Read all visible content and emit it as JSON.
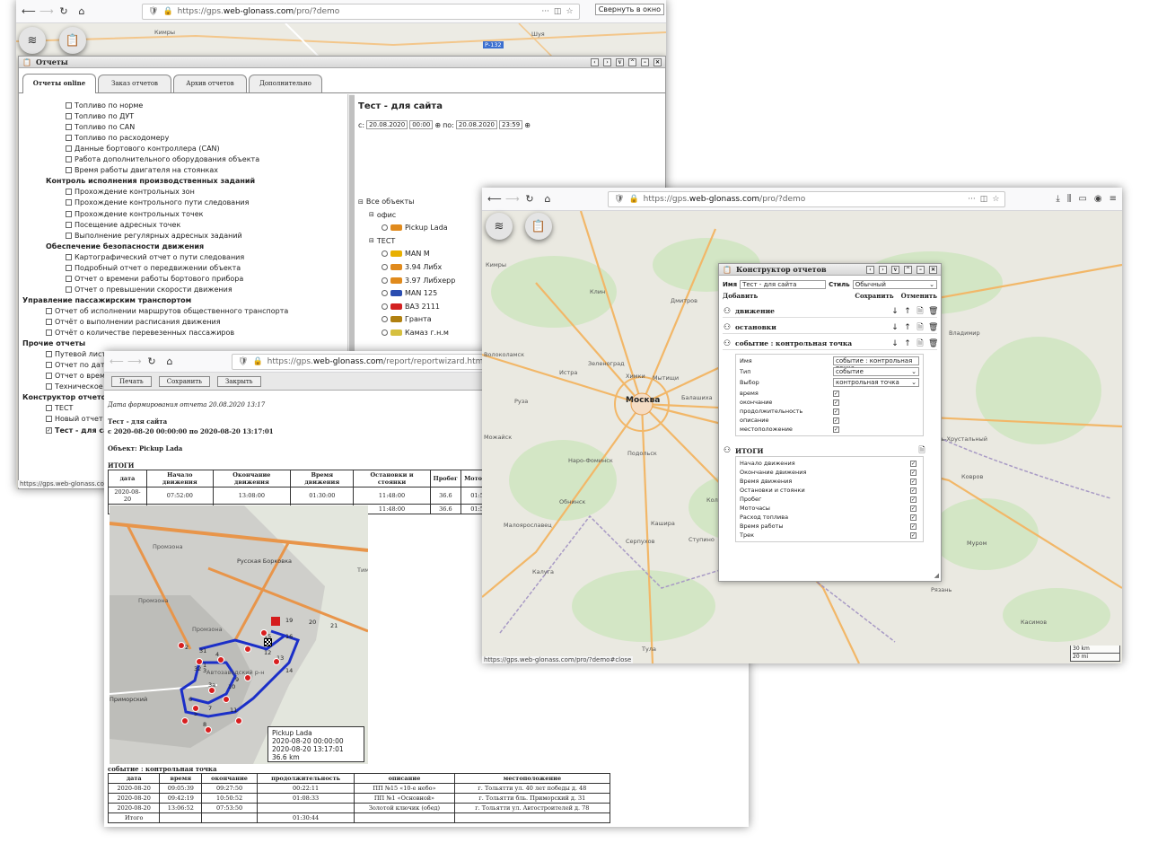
{
  "win1": {
    "url": {
      "prefix": "https://gps.",
      "domain": "web-glonass.com",
      "suffix": "/pro/?demo"
    },
    "tooltip": "Свернуть в окно",
    "map_labels": [
      "Кимры",
      "Шуя",
      "Р-132"
    ],
    "reports_title": "Отчеты",
    "tabs": [
      "Отчеты online",
      "Заказ отчетов",
      "Архив отчетов",
      "Дополнительно"
    ],
    "tree": [
      {
        "t": "Топливо по норме",
        "lvl": 2,
        "k": "cb"
      },
      {
        "t": "Топливо по ДУТ",
        "lvl": 2,
        "k": "cb"
      },
      {
        "t": "Топливо по CAN",
        "lvl": 2,
        "k": "cb"
      },
      {
        "t": "Топливо по расходомеру",
        "lvl": 2,
        "k": "cb"
      },
      {
        "t": "Данные бортового контроллера (CAN)",
        "lvl": 2,
        "k": "cb"
      },
      {
        "t": "Работа дополнительного оборудования объекта",
        "lvl": 2,
        "k": "cb"
      },
      {
        "t": "Время работы двигателя на стоянках",
        "lvl": 2,
        "k": "cb"
      },
      {
        "t": "Контроль исполнения производственных заданий",
        "lvl": 1,
        "k": "hdr"
      },
      {
        "t": "Прохождение контрольных зон",
        "lvl": 2,
        "k": "cb"
      },
      {
        "t": "Прохождение контрольного пути следования",
        "lvl": 2,
        "k": "cb"
      },
      {
        "t": "Прохождение контрольных точек",
        "lvl": 2,
        "k": "cb"
      },
      {
        "t": "Посещение адресных точек",
        "lvl": 2,
        "k": "cb"
      },
      {
        "t": "Выполнение регулярных адресных заданий",
        "lvl": 2,
        "k": "cb"
      },
      {
        "t": "Обеспечение безопасности движения",
        "lvl": 1,
        "k": "hdr"
      },
      {
        "t": "Картографический отчет о пути следования",
        "lvl": 2,
        "k": "cb"
      },
      {
        "t": "Подробный отчет о передвижении объекта",
        "lvl": 2,
        "k": "cb"
      },
      {
        "t": "Отчет о времени работы бортового прибора",
        "lvl": 2,
        "k": "cb"
      },
      {
        "t": "Отчет о превышении скорости движения",
        "lvl": 2,
        "k": "cb"
      },
      {
        "t": "Управление пассажирским транспортом",
        "lvl": 0,
        "k": "hdr"
      },
      {
        "t": "Отчет об исполнении маршрутов общественного транспорта",
        "lvl": 1,
        "k": "cb"
      },
      {
        "t": "Отчёт о выполнении расписания движения",
        "lvl": 1,
        "k": "cb"
      },
      {
        "t": "Отчёт о количестве перевезенных пассажиров",
        "lvl": 1,
        "k": "cb"
      },
      {
        "t": "Прочие отчеты",
        "lvl": 0,
        "k": "hdr"
      },
      {
        "t": "Путевой лист",
        "lvl": 1,
        "k": "cb"
      },
      {
        "t": "Отчет по датчи",
        "lvl": 1,
        "k": "cb"
      },
      {
        "t": "Отчет о времен",
        "lvl": 1,
        "k": "cb"
      },
      {
        "t": "Техническое об",
        "lvl": 1,
        "k": "cb"
      },
      {
        "t": "Конструктор отчетов",
        "lvl": 0,
        "k": "hdr"
      },
      {
        "t": "ТЕСТ",
        "lvl": 1,
        "k": "cb"
      },
      {
        "t": "Новый отчет",
        "lvl": 1,
        "k": "cb"
      },
      {
        "t": "Тест - для сай",
        "lvl": 1,
        "k": "cbx"
      }
    ],
    "report_name": "Тест - для сайта",
    "date_from_label": "с:",
    "date_from": "20.08.2020",
    "time_from": "00:00",
    "date_to_label": "по:",
    "date_to": "20.08.2020",
    "time_to": "23:59",
    "objects": [
      {
        "t": "Все объекты",
        "lvl": 0,
        "k": "grp",
        "c": ""
      },
      {
        "t": "офис",
        "lvl": 1,
        "k": "grp",
        "c": ""
      },
      {
        "t": "Pickup Lada",
        "lvl": 2,
        "k": "obj",
        "c": "#e08a1c"
      },
      {
        "t": "ТЕСТ",
        "lvl": 1,
        "k": "grp",
        "c": ""
      },
      {
        "t": "MAN M",
        "lvl": 2,
        "k": "obj",
        "c": "#e8b000"
      },
      {
        "t": "3.94 Либх",
        "lvl": 2,
        "k": "obj",
        "c": "#e08a1c"
      },
      {
        "t": "3.97 Либхерр",
        "lvl": 2,
        "k": "obj",
        "c": "#e08a1c"
      },
      {
        "t": "MAN 125",
        "lvl": 2,
        "k": "obj",
        "c": "#2a4db0"
      },
      {
        "t": "ВАЗ 2111",
        "lvl": 2,
        "k": "obj",
        "c": "#d32020"
      },
      {
        "t": "Гранта",
        "lvl": 2,
        "k": "obj",
        "c": "#b08010"
      },
      {
        "t": "Камаз г.н.м",
        "lvl": 2,
        "k": "obj",
        "c": "#d6c040"
      }
    ],
    "status_url": "https://gps.web-glonass.com/p"
  },
  "win2": {
    "url": {
      "prefix": "https://gps.",
      "domain": "web-glonass.com",
      "suffix": "/report/reportwizard.html"
    },
    "buttons": [
      "Печать",
      "Сохранить",
      "Закрыть"
    ],
    "date_line": "Дата формирования отчета 20.08.2020 13:17",
    "title": "Тест - для сайта",
    "period": "с 2020-08-20 00:00:00 по 2020-08-20 13:17:01",
    "object_line": "Объект: Pickup Lada",
    "totals_title": "ИТОГИ",
    "totals_headers": [
      "дата",
      "Начало движения",
      "Окончание движения",
      "Время движения",
      "Остановки и стоянки",
      "Пробег",
      "Моточа"
    ],
    "totals_rows": [
      [
        "2020-08-20",
        "07:52:00",
        "13:08:00",
        "01:30:00",
        "11:48:00",
        "36.6",
        "01:5"
      ],
      [
        "Итого",
        "",
        "",
        "01:30:00",
        "11:48:00",
        "36.6",
        "01:5"
      ]
    ],
    "map_labels": [
      "Промзона",
      "Русская Борковка",
      "Промзона",
      "Промзона",
      "Автозаводский р-н",
      "Приморский",
      "Тимо"
    ],
    "track_nums": [
      "19",
      "20",
      "21",
      "15",
      "16",
      "13",
      "12",
      "14",
      "2",
      "31",
      "4",
      "1",
      "32",
      "3",
      "9",
      "3a",
      "6",
      "10",
      "5",
      "7",
      "11",
      "8"
    ],
    "infobox": {
      "line1": "Pickup Lada",
      "line2": "2020-08-20 00:00:00",
      "line3": "2020-08-20 13:17:01",
      "line4": "36.6 km"
    },
    "events_title": "событие : контрольная точка",
    "events_headers": [
      "дата",
      "время",
      "окончание",
      "продолжительность",
      "описание",
      "местоположение"
    ],
    "events_rows": [
      [
        "2020-08-20",
        "09:05:39",
        "09:27:50",
        "00:22:11",
        "ПП №15 «10-е небо»",
        "г. Тольятти ул. 40 лет победы д. 48"
      ],
      [
        "2020-08-20",
        "09:42:19",
        "10:50:52",
        "01:08:33",
        "ПП №1 «Основной»",
        "г. Тольятти бль. Приморский д. 31"
      ],
      [
        "2020-08-20",
        "13:06:52",
        "07:53:50",
        "",
        "Золотой ключик (обед)",
        "г. Тольятти ул. Автостроителей д. 78"
      ],
      [
        "Итого",
        "",
        "",
        "01:30:44",
        "",
        ""
      ]
    ]
  },
  "win3": {
    "url": {
      "prefix": "https://gps.",
      "domain": "web-glonass.com",
      "suffix": "/pro/?demo"
    },
    "status_url": "https://gps.web-glonass.com/pro/?demo#close",
    "map_cities": [
      {
        "t": "Москва",
        "b": true
      },
      {
        "t": "Химки"
      },
      {
        "t": "Балашиха"
      },
      {
        "t": "Мытищи"
      },
      {
        "t": "Подольск"
      },
      {
        "t": "Серпухов"
      },
      {
        "t": "Коломна"
      },
      {
        "t": "Тула"
      },
      {
        "t": "Калуга"
      },
      {
        "t": "Муром"
      },
      {
        "t": "Ковров"
      },
      {
        "t": "Обнинск"
      },
      {
        "t": "Наро-Фоминск"
      },
      {
        "t": "Зеленоград"
      },
      {
        "t": "Сергиев Посад"
      },
      {
        "t": "Дмитров"
      },
      {
        "t": "Клин"
      },
      {
        "t": "Шатура"
      },
      {
        "t": "Рязань"
      },
      {
        "t": "Егорьевск"
      },
      {
        "t": "Кашира"
      },
      {
        "t": "Ступино"
      },
      {
        "t": "Ногинск"
      },
      {
        "t": "Орехово-Зуево"
      },
      {
        "t": "Владимир"
      },
      {
        "t": "Гусь-Хрустальный"
      },
      {
        "t": "Касимов"
      },
      {
        "t": "Малоярославец"
      },
      {
        "t": "Волоколамск"
      },
      {
        "t": "Руза"
      },
      {
        "t": "Можайск"
      },
      {
        "t": "Истра"
      },
      {
        "t": "Кимры"
      }
    ],
    "scale": [
      "30 km",
      "20 mi"
    ],
    "constructor": {
      "title": "Конструктор отчетов",
      "name_label": "Имя",
      "name_value": "Тест - для сайта",
      "style_label": "Стиль",
      "style_value": "Обычный",
      "add_label": "Добавить",
      "save_label": "Сохранить",
      "cancel_label": "Отменить",
      "sections": [
        "движение",
        "остановки",
        "событие : контрольная точка"
      ],
      "fields": {
        "name_label": "Имя",
        "name_value": "событие : контрольная точка",
        "type_label": "Тип",
        "type_value": "событие",
        "choice_label": "Выбор",
        "choice_value": "контрольная точка"
      },
      "event_checks": [
        "время",
        "окончание",
        "продолжительность",
        "описание",
        "местоположение"
      ],
      "totals_title": "ИТОГИ",
      "totals_checks": [
        "Начало движения",
        "Окончание движения",
        "Время движения",
        "Остановки и стоянки",
        "Пробег",
        "Моточасы",
        "Расход топлива",
        "Время работы",
        "Трек"
      ]
    }
  }
}
